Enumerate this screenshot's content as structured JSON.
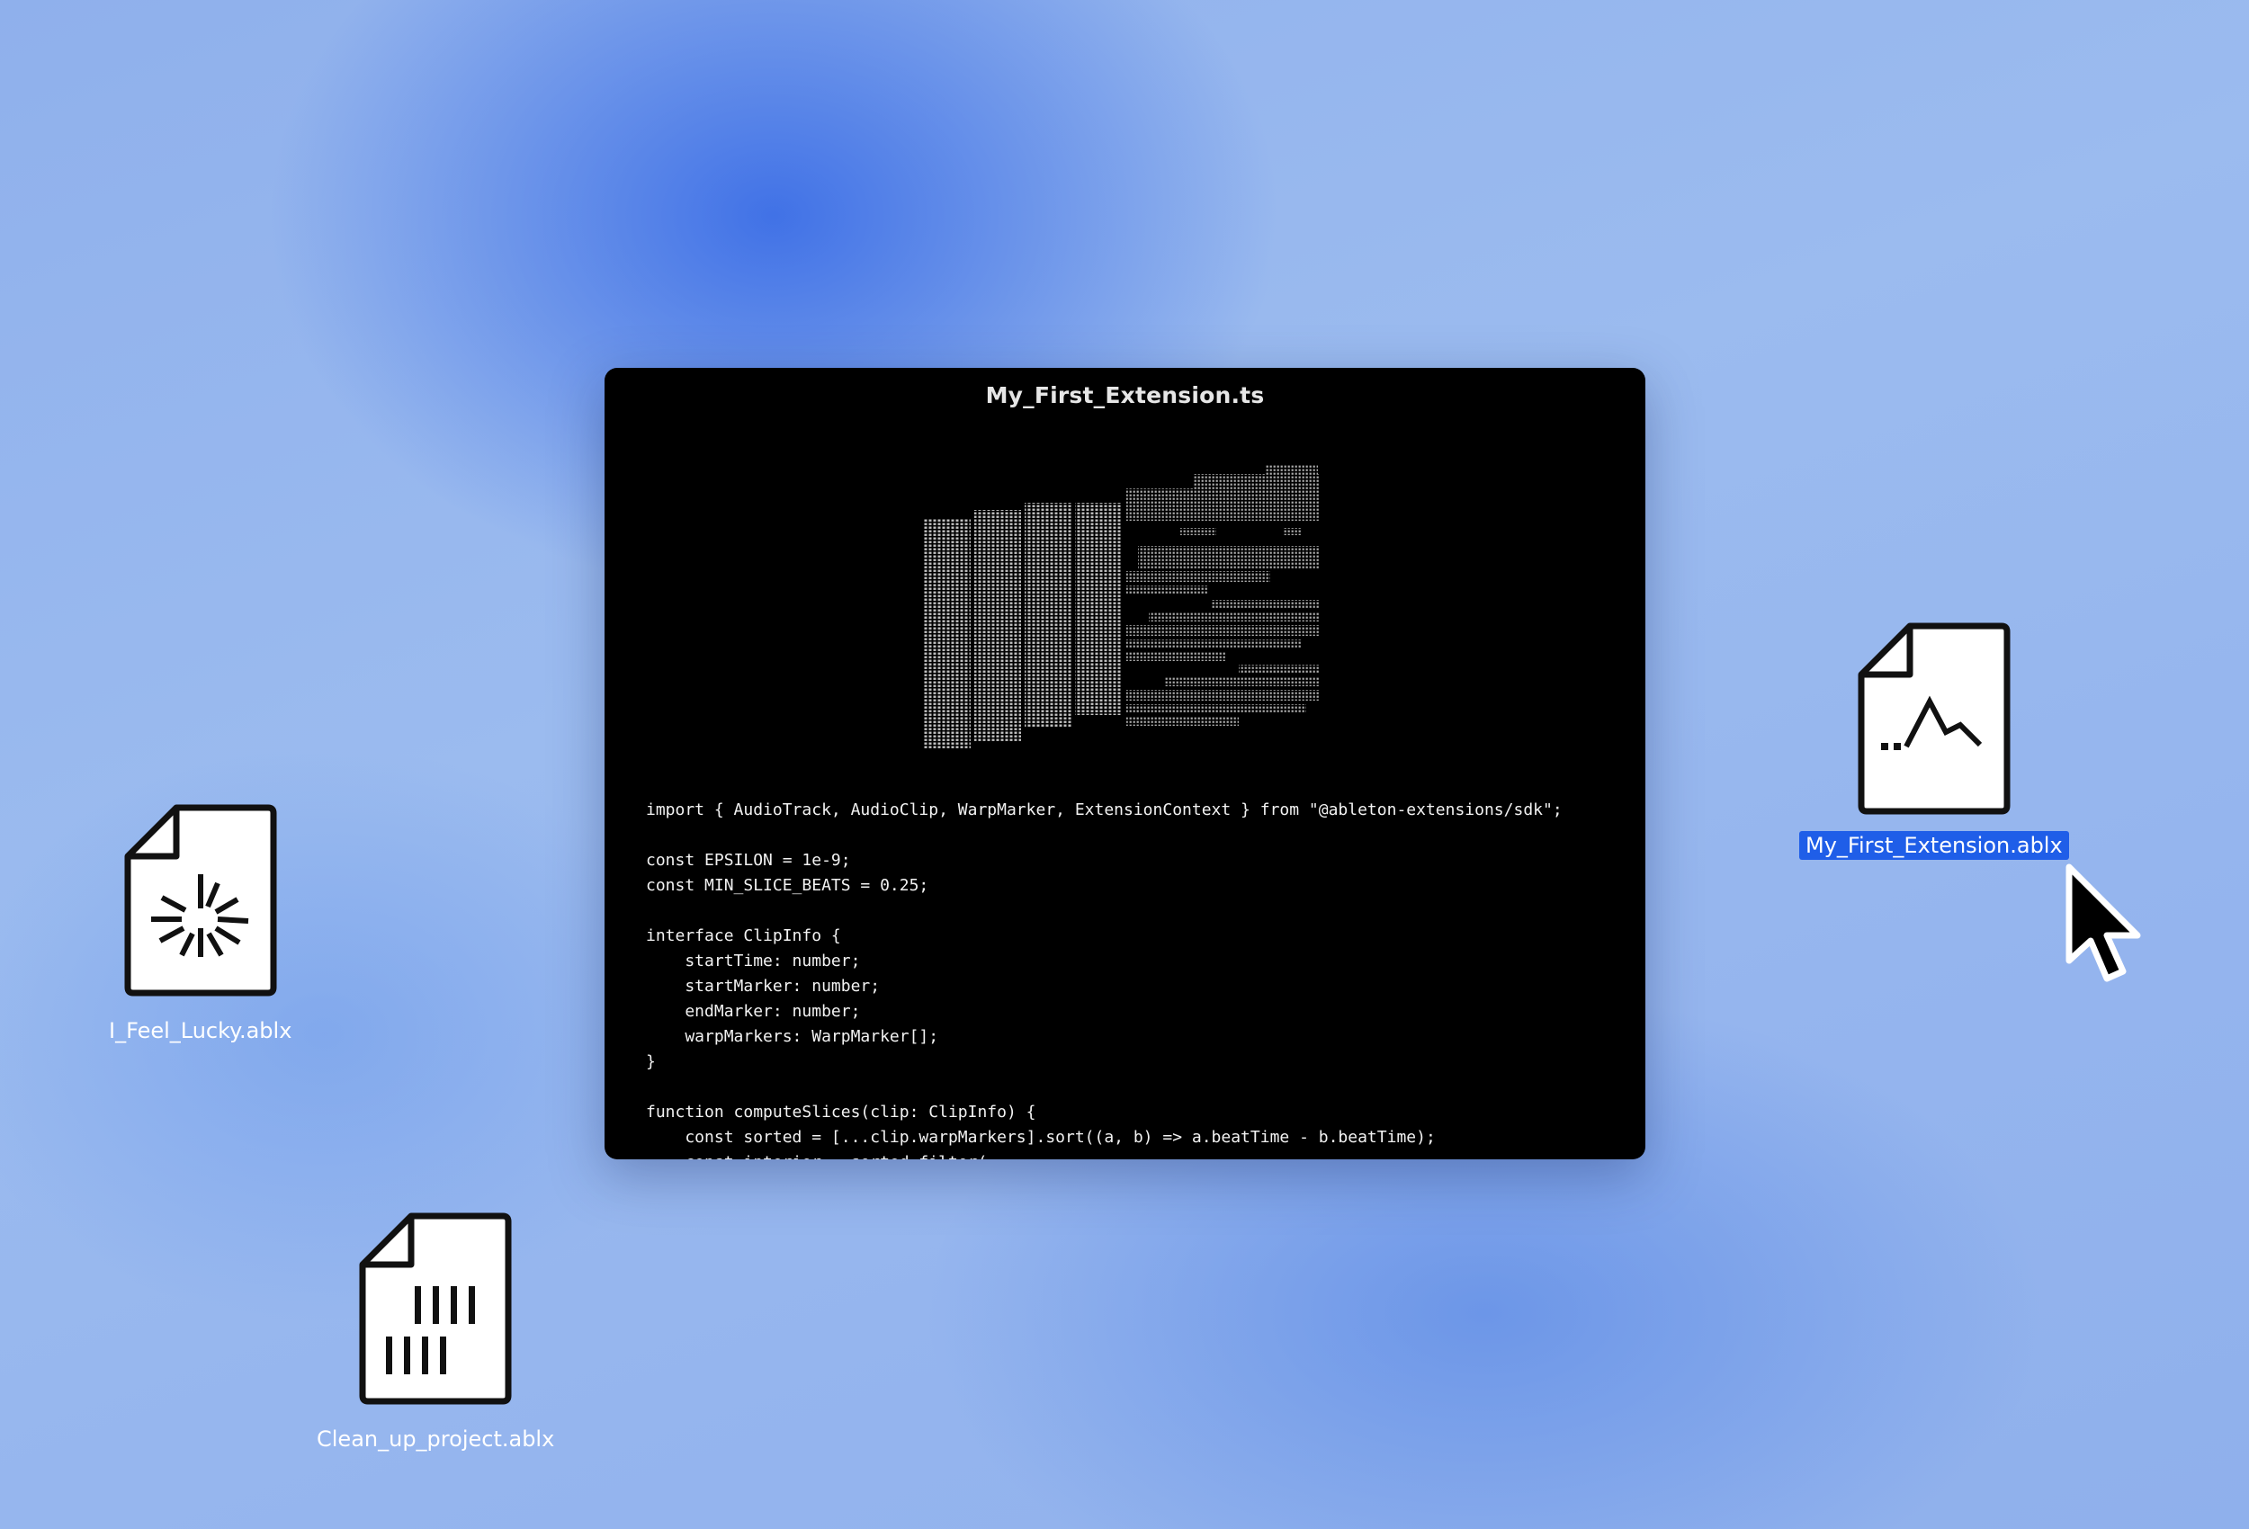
{
  "window": {
    "title": "My_First_Extension.ts",
    "code_lines": [
      "import { AudioTrack, AudioClip, WarpMarker, ExtensionContext } from \"@ableton-extensions/sdk\";",
      "",
      "const EPSILON = 1e-9;",
      "const MIN_SLICE_BEATS = 0.25;",
      "",
      "interface ClipInfo {",
      "    startTime: number;",
      "    startMarker: number;",
      "    endMarker: number;",
      "    warpMarkers: WarpMarker[];",
      "}",
      "",
      "function computeSlices(clip: ClipInfo) {",
      "    const sorted = [...clip.warpMarkers].sort((a, b) => a.beatTime - b.beatTime);",
      "    const interior = sorted.filter("
    ]
  },
  "desktop": {
    "files": [
      {
        "name": "I_Feel_Lucky.ablx",
        "icon": "starburst-file-icon",
        "selected": false
      },
      {
        "name": "Clean_up_project.ablx",
        "icon": "bars-file-icon",
        "selected": false
      },
      {
        "name": "My_First_Extension.ablx",
        "icon": "waveform-file-icon",
        "selected": true
      }
    ]
  },
  "colors": {
    "selection": "#1f5ee8",
    "window_bg": "#000000"
  }
}
